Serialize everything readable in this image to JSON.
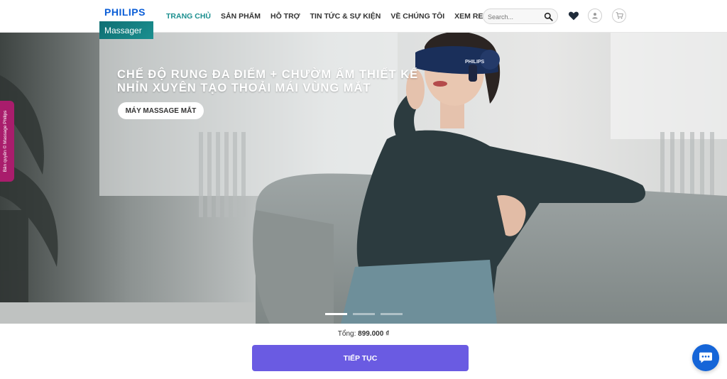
{
  "brand": {
    "name": "PHILIPS",
    "sub": "Massager"
  },
  "nav": [
    {
      "label": "TRANG CHỦ",
      "active": true
    },
    {
      "label": "SẢN PHẨM"
    },
    {
      "label": "HỖ TRỢ"
    },
    {
      "label": "TIN TỨC & SỰ KIỆN"
    },
    {
      "label": "VỀ CHÚNG TÔI"
    },
    {
      "label": "XEM REVIEW"
    }
  ],
  "search": {
    "placeholder": "Search..."
  },
  "hero": {
    "title": "CHẾ ĐỘ RUNG ĐA ĐIỂM + CHƯỜM ẤM THIẾT KẾ NHỈN XUYÊN TẠO THOẢI MÁI VÙNG MẮT",
    "button_label": "MÁY MASSAGE MẮT",
    "device_brand": "PHILIPS",
    "active_slide": 1,
    "slides": 3
  },
  "side_tab": {
    "label": "Bản quyền © Massage Philips"
  },
  "order": {
    "total_label": "Tổng:",
    "total_amount": "899.000 ₫",
    "cta_label": "TIẾP TỤC"
  },
  "colors": {
    "accent": "#1b8f8f",
    "cta": "#6a5be2",
    "side_tab": "#a91d6c",
    "chat": "#1565d8"
  },
  "icons": [
    "search-icon",
    "heart-icon",
    "user-icon",
    "cart-icon",
    "chat-icon"
  ]
}
